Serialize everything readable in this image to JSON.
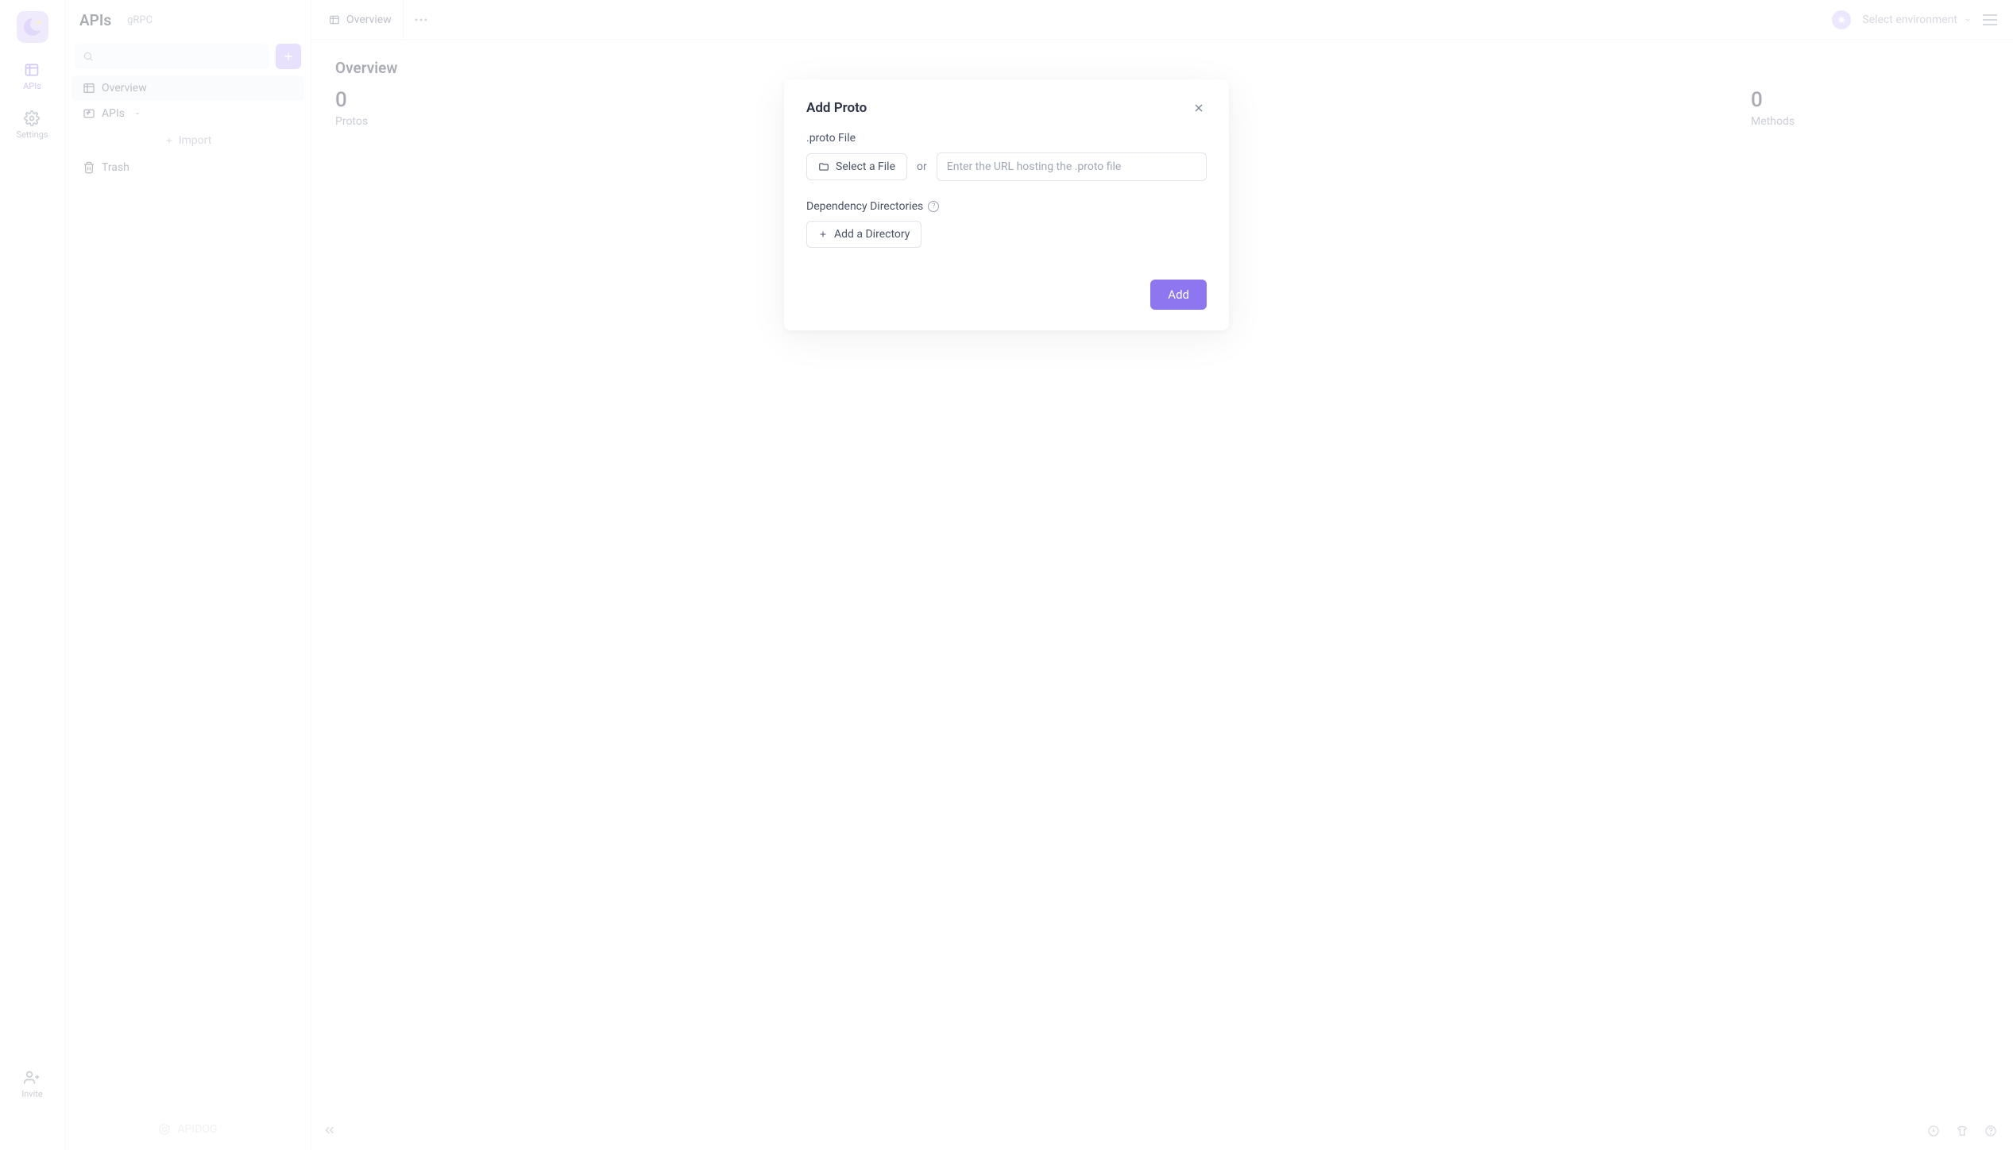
{
  "nav": {
    "apis": "APIs",
    "settings": "Settings",
    "invite": "Invite"
  },
  "sidebar": {
    "title": "APIs",
    "subtitle": "gRPC",
    "overview": "Overview",
    "apis": "APIs",
    "import": "Import",
    "trash": "Trash",
    "brand": "APIDOG"
  },
  "tabs": {
    "overview": "Overview"
  },
  "env": {
    "placeholder": "Select environment"
  },
  "page": {
    "title": "Overview",
    "stat_protos_value": "0",
    "stat_protos_label": "Protos",
    "stat_methods_value": "0",
    "stat_methods_label": "Methods"
  },
  "modal": {
    "title": "Add Proto",
    "proto_file_label": ".proto File",
    "select_file": "Select a File",
    "or": "or",
    "url_placeholder": "Enter the URL hosting the .proto file",
    "dep_dirs_label": "Dependency Directories",
    "add_directory": "Add a Directory",
    "add_button": "Add"
  }
}
